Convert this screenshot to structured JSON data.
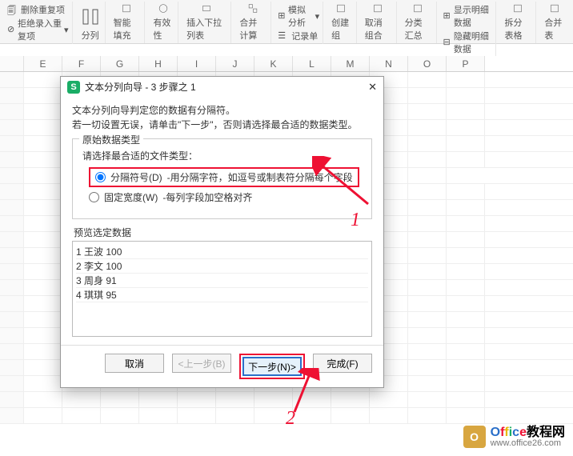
{
  "ribbon": {
    "dup_title": "删除重复项",
    "dup_reject": "拒绝录入重复项",
    "split_col": "分列",
    "smart_fill": "智能填充",
    "validity": "有效性",
    "insert_dropdown": "插入下拉列表",
    "merge_calc": "合并计算",
    "record_sheet": "记录单",
    "create_group": "创建组",
    "ungroup": "取消组合",
    "subtotal": "分类汇总",
    "show_detail": "显示明细数据",
    "hide_detail": "隐藏明细数据",
    "mock_analysis": "模拟分析",
    "split_table": "拆分表格",
    "merge_table": "合并表"
  },
  "columns": [
    "",
    "E",
    "F",
    "G",
    "H",
    "I",
    "J",
    "K",
    "L",
    "M",
    "N",
    "O",
    "P"
  ],
  "dialog": {
    "title": "文本分列向导 - 3 步骤之 1",
    "desc1": "文本分列向导判定您的数据有分隔符。",
    "desc2": "若一切设置无误，请单击\"下一步\"，否则请选择最合适的数据类型。",
    "section_title": "原始数据类型",
    "section_prompt": "请选择最合适的文件类型：",
    "radio1_label": "分隔符号(D)",
    "radio1_desc": "-用分隔字符，如逗号或制表符分隔每个字段",
    "radio2_label": "固定宽度(W)",
    "radio2_desc": "-每列字段加空格对齐",
    "preview_label": "预览选定数据",
    "preview_rows": [
      {
        "n": "1",
        "t": "王波 100"
      },
      {
        "n": "2",
        "t": "李文 100"
      },
      {
        "n": "3",
        "t": "周身 91"
      },
      {
        "n": "4",
        "t": "琪琪 95"
      }
    ],
    "btn_cancel": "取消",
    "btn_back": "<上一步(B)",
    "btn_next": "下一步(N)>",
    "btn_finish": "完成(F)"
  },
  "annotations": {
    "num1": "1",
    "num2": "2"
  },
  "watermark": {
    "brand": "Office",
    "suffix": "教程网",
    "url": "www.office26.com"
  }
}
